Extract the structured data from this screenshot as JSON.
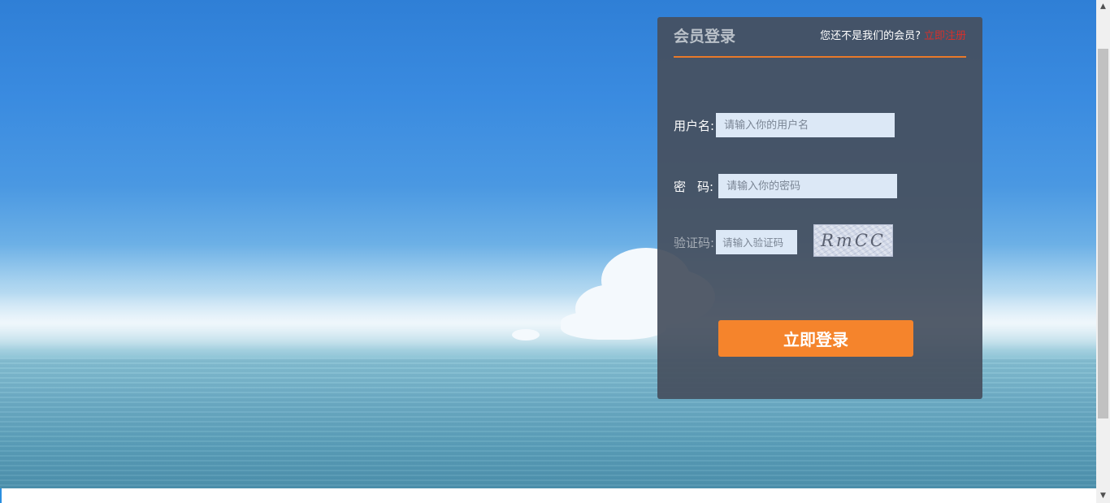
{
  "panel": {
    "title": "会员登录",
    "register_prompt": "您还不是我们的会员?",
    "register_link": "立即注册"
  },
  "form": {
    "username": {
      "label": "用户名:",
      "placeholder": "请输入你的用户名",
      "value": ""
    },
    "password": {
      "label": "密码",
      "colon": ":",
      "placeholder": "请输入你的密码",
      "value": ""
    },
    "captcha": {
      "label": "验证码:",
      "placeholder": "请输入验证码",
      "value": "",
      "image_text": "RmCC"
    },
    "submit_label": "立即登录"
  },
  "colors": {
    "accent": "#f5842c",
    "link_red": "#d6302b",
    "panel_bg": "#46505f",
    "input_bg": "#dce8f6"
  },
  "icons": {
    "scroll_up": "triangle-up-icon",
    "scroll_down": "triangle-down-icon"
  }
}
